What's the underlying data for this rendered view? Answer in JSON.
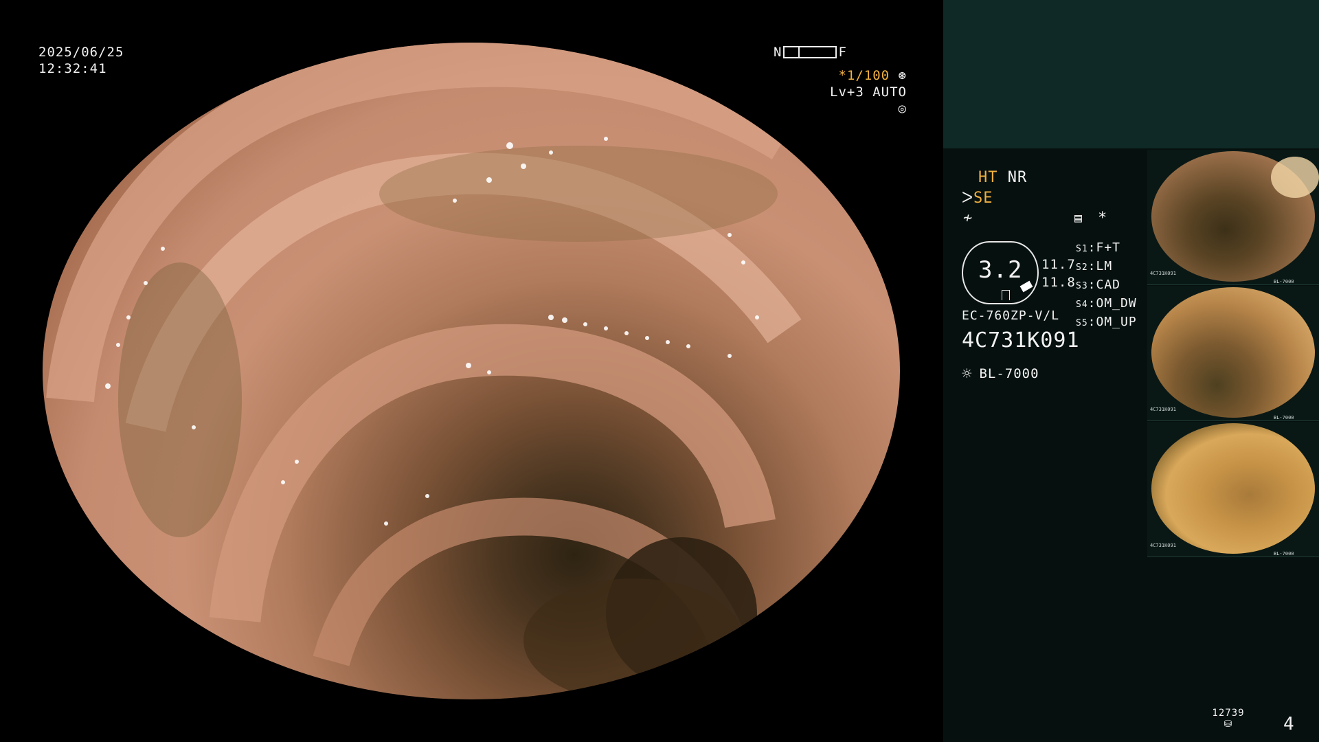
{
  "osd": {
    "date": "2025/06/25",
    "time": "12:32:41",
    "nf_left": "N",
    "nf_right": "F",
    "shutter": "*1/100",
    "shutter_icon": "aperture-icon",
    "iris": "Lv+3  AUTO",
    "iris_icon": "auto-iris-icon"
  },
  "panel": {
    "ht": "HT",
    "nr": "NR",
    "se": "SE",
    "se_icon": "structure-enhance-icon",
    "color_icon": "color-mode-icon",
    "menu_icon": "memory-icon",
    "star": "*",
    "zoom_value": "3.2",
    "val_top": "11.7",
    "val_bottom": "11.8",
    "scope_model": "EC-760ZP-V/L",
    "serial": "4C731K091",
    "light_icon": "light-source-icon",
    "light_source": "BL-7000",
    "switches": [
      {
        "key": "S1",
        "val": "F+T"
      },
      {
        "key": "S2",
        "val": "LM"
      },
      {
        "key": "S3",
        "val": "CAD"
      },
      {
        "key": "S4",
        "val": "OM_DW"
      },
      {
        "key": "S5",
        "val": "OM_UP"
      }
    ],
    "counter_value": "12739",
    "counter_icon": "storage-icon",
    "image_count": "4"
  },
  "thumbnails": [
    {
      "caption": "4C731K091",
      "light": "BL-7000"
    },
    {
      "caption": "4C731K091",
      "light": "BL-7000"
    },
    {
      "caption": "4C731K091",
      "light": "BL-7000"
    }
  ],
  "colors": {
    "panel_top": "#0f2a26",
    "panel": "#06110f",
    "highlight": "#f0b040"
  }
}
